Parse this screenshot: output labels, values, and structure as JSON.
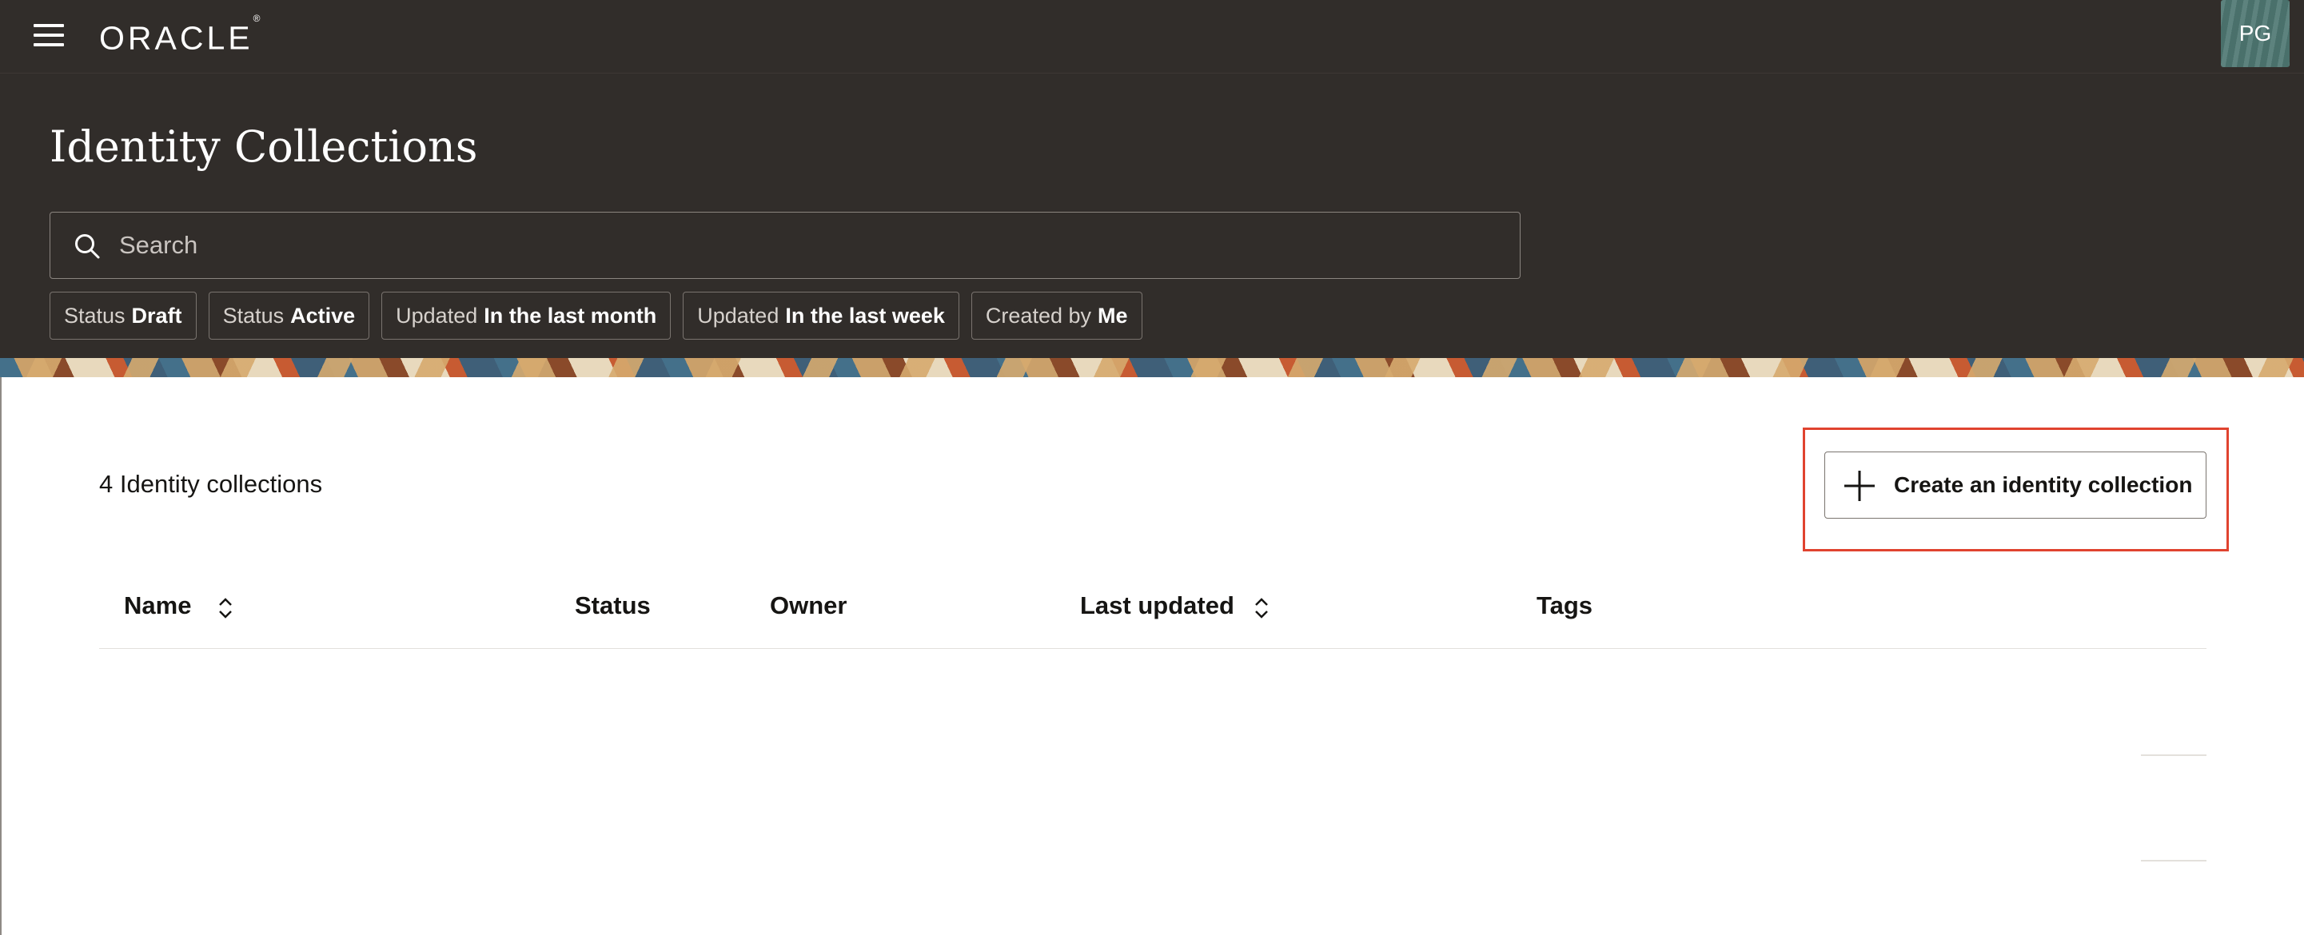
{
  "topbar": {
    "menu_icon": "hamburger-menu-icon",
    "logo_text": "ORACLE",
    "logo_mark": "®",
    "avatar_initials": "PG",
    "avatar_color": "#4f7873"
  },
  "header": {
    "title": "Identity Collections",
    "search": {
      "placeholder": "Search",
      "value": "",
      "icon": "search-icon"
    },
    "filters": [
      {
        "key": "Status",
        "value": "Draft"
      },
      {
        "key": "Status",
        "value": "Active"
      },
      {
        "key": "Updated",
        "value": "In the last month"
      },
      {
        "key": "Updated",
        "value": "In the last week"
      },
      {
        "key": "Created by",
        "value": "Me"
      }
    ]
  },
  "main": {
    "count_label": "4 Identity collections",
    "create_button": {
      "label": "Create an identity collection",
      "icon": "plus-icon"
    },
    "highlight_color": "#e0432f",
    "table": {
      "columns": [
        {
          "label": "Name",
          "sortable": true
        },
        {
          "label": "Status",
          "sortable": false
        },
        {
          "label": "Owner",
          "sortable": false
        },
        {
          "label": "Last updated",
          "sortable": true
        },
        {
          "label": "Tags",
          "sortable": false
        }
      ],
      "rows": []
    }
  },
  "colors": {
    "header_bg": "#312d2a",
    "text_primary": "#161513",
    "accent_highlight": "#e0432f"
  }
}
